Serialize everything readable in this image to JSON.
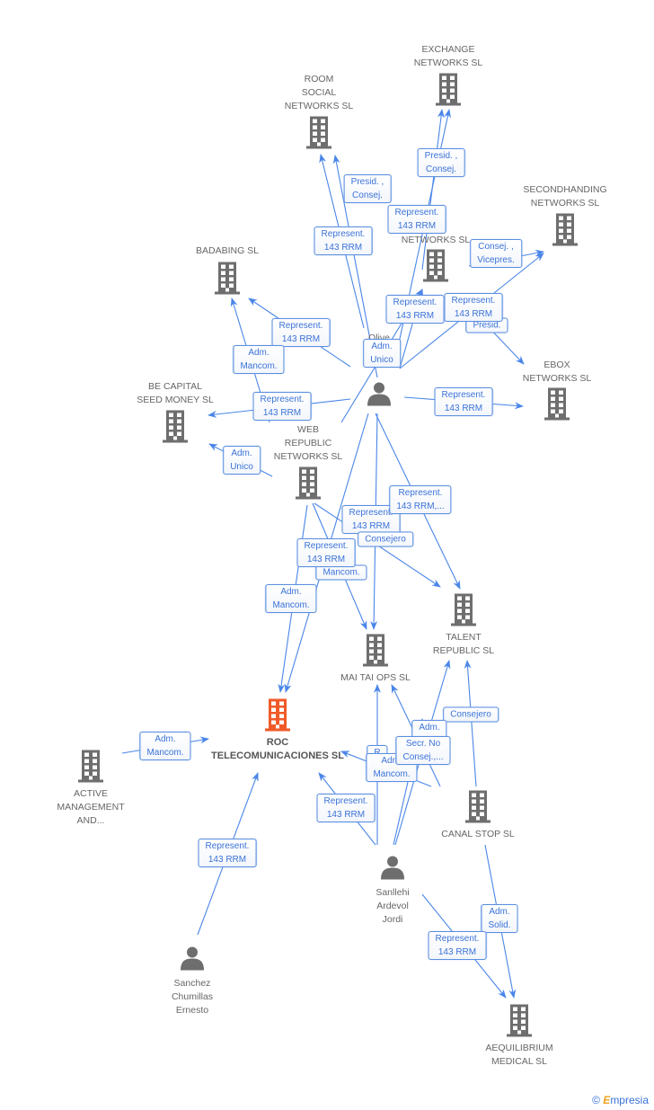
{
  "colors": {
    "edge": "#4a86e8",
    "node_icon": "#6e6e6e",
    "focus_icon": "#f05a28",
    "label_text": "#3a72d8"
  },
  "nodes": [
    {
      "id": "exchange",
      "type": "company",
      "lines": [
        "EXCHANGE",
        "NETWORKS SL"
      ]
    },
    {
      "id": "room",
      "type": "company",
      "lines": [
        "ROOM",
        "SOCIAL",
        "NETWORKS SL"
      ]
    },
    {
      "id": "second",
      "type": "company",
      "lines": [
        "SECONDHANDING",
        "NETWORKS SL"
      ]
    },
    {
      "id": "story",
      "type": "company",
      "lines": [
        "RY",
        "NETWORKS SL"
      ]
    },
    {
      "id": "badabing",
      "type": "company",
      "lines": [
        "BADABING SL"
      ]
    },
    {
      "id": "ebox",
      "type": "company",
      "lines": [
        "EBOX",
        "NETWORKS SL"
      ]
    },
    {
      "id": "becapital",
      "type": "company",
      "lines": [
        "BE CAPITAL",
        "SEED MONEY SL"
      ]
    },
    {
      "id": "olive",
      "type": "person",
      "lines": [
        "Olive",
        "Fe",
        "C"
      ]
    },
    {
      "id": "web",
      "type": "company",
      "lines": [
        "WEB",
        "REPUBLIC",
        "NETWORKS  SL"
      ]
    },
    {
      "id": "talent",
      "type": "company",
      "lines": [
        "TALENT",
        "REPUBLIC  SL"
      ]
    },
    {
      "id": "maitai",
      "type": "company",
      "lines": [
        "MAI TAI OPS  SL"
      ]
    },
    {
      "id": "roc",
      "type": "focus",
      "lines": [
        "ROC",
        "TELECOMUNICACIONES SL"
      ]
    },
    {
      "id": "active",
      "type": "company",
      "lines": [
        "ACTIVE",
        "MANAGEMENT",
        "AND..."
      ]
    },
    {
      "id": "canal",
      "type": "company",
      "lines": [
        "CANAL STOP SL"
      ]
    },
    {
      "id": "sanllehi",
      "type": "person",
      "lines": [
        "Sanllehi",
        "Ardevol",
        "Jordi"
      ]
    },
    {
      "id": "sanchez",
      "type": "person",
      "lines": [
        "Sanchez",
        "Chumillas",
        "Ernesto"
      ]
    },
    {
      "id": "aequi",
      "type": "company",
      "lines": [
        "AEQUILIBRIUM",
        "MEDICAL  SL"
      ]
    }
  ],
  "edge_labels": [
    {
      "id": "e1",
      "lines": [
        "Represent.",
        "143 RRM"
      ]
    },
    {
      "id": "e2",
      "lines": [
        "Presid. ,",
        "Consej."
      ]
    },
    {
      "id": "e3",
      "lines": [
        "Presid. ,",
        "Consej."
      ]
    },
    {
      "id": "e4",
      "lines": [
        "Represent.",
        "143 RRM"
      ]
    },
    {
      "id": "e5",
      "lines": [
        "Consej. ,",
        "Vicepres."
      ]
    },
    {
      "id": "e6",
      "lines": [
        "Presid."
      ]
    },
    {
      "id": "e7",
      "lines": [
        "Represent.",
        "143 RRM"
      ]
    },
    {
      "id": "e8",
      "lines": [
        "Represent.",
        "143 RRM"
      ]
    },
    {
      "id": "e9",
      "lines": [
        "Adm.",
        "Unico"
      ]
    },
    {
      "id": "e10",
      "lines": [
        "Represent.",
        "143 RRM"
      ]
    },
    {
      "id": "e11",
      "lines": [
        "Adm.",
        "Mancom."
      ]
    },
    {
      "id": "e12",
      "lines": [
        "Represent.",
        "143 RRM"
      ]
    },
    {
      "id": "e13",
      "lines": [
        "Adm.",
        "Unico"
      ]
    },
    {
      "id": "e14",
      "lines": [
        "Represent.",
        "143 RRM"
      ]
    },
    {
      "id": "e15",
      "lines": [
        "Represent.",
        "143 RRM"
      ]
    },
    {
      "id": "e16",
      "lines": [
        "Represent.",
        "143 RRM,..."
      ]
    },
    {
      "id": "e17",
      "lines": [
        "Consejero"
      ]
    },
    {
      "id": "e18",
      "lines": [
        "Mancom."
      ]
    },
    {
      "id": "e19",
      "lines": [
        "Represent.",
        "143 RRM"
      ]
    },
    {
      "id": "e20",
      "lines": [
        "Adm.",
        "Mancom."
      ]
    },
    {
      "id": "e21",
      "lines": [
        "Adm.",
        "Mancom."
      ]
    },
    {
      "id": "e22",
      "lines": [
        "Represent.",
        "143 RRM"
      ]
    },
    {
      "id": "e23",
      "lines": [
        "Represent.",
        "143 RRM"
      ]
    },
    {
      "id": "e24",
      "lines": [
        "Consejero"
      ]
    },
    {
      "id": "e25",
      "lines": [
        "Adm.",
        ""
      ]
    },
    {
      "id": "e26",
      "lines": [
        "R",
        ""
      ]
    },
    {
      "id": "e27",
      "lines": [
        "Adm.",
        "Mancom."
      ]
    },
    {
      "id": "e28",
      "lines": [
        "Secr.  No",
        "Consej.,..."
      ]
    },
    {
      "id": "e29",
      "lines": [
        "Adm.",
        "Solid."
      ]
    },
    {
      "id": "e30",
      "lines": [
        "Represent.",
        "143 RRM"
      ]
    }
  ],
  "footer": {
    "copyright": "©",
    "brand_initial": "E",
    "brand_rest": "mpresia"
  }
}
